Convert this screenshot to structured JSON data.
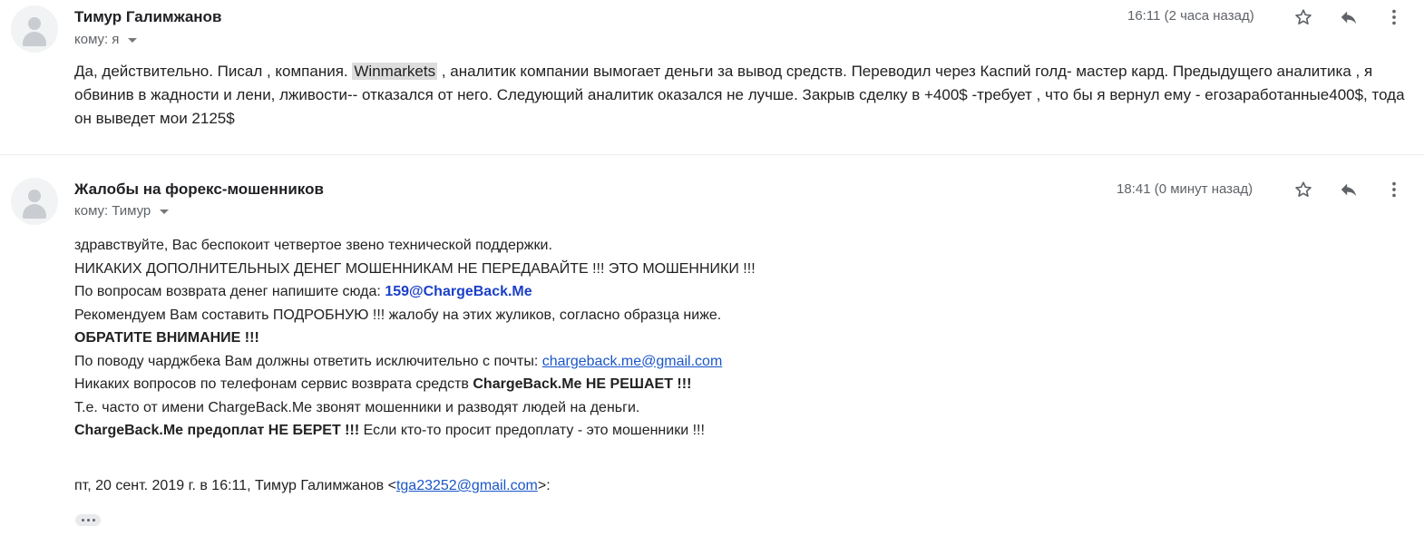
{
  "messages": [
    {
      "sender": "Тимур Галимжанов",
      "to_prefix": "кому:",
      "to_name": "я",
      "time": "16:11 (2 часа назад)",
      "body": {
        "part1": "Да, действительно. Писал , компания. ",
        "highlight": "Winmarkets",
        "part2": " , аналитик компании вымогает деньги за вывод средств. Переводил через Каспий голд- мастер кард. Предыдущего аналитика , я обвинив в жадности и лени, лживости-- отказался от него. Следующий аналитик оказался не лучше. Закрыв сделку в +400$ -требует , что бы я вернул ему - егозаработанные400$, тода он выведет мои 2125$"
      }
    },
    {
      "sender": "Жалобы на форекс-мошенников",
      "to_prefix": "кому:",
      "to_name": "Тимур",
      "time": "18:41 (0 минут назад)",
      "body": {
        "line1": "здравствуйте, Вас беспокоит четвертое звено технической поддержки.",
        "line2": "НИКАКИХ ДОПОЛНИТЕЛЬНЫХ ДЕНЕГ МОШЕННИКАМ НЕ ПЕРЕДАВАЙТЕ !!! ЭТО МОШЕННИКИ !!!",
        "line3_text": "По вопросам возврата денег напишите сюда: ",
        "line3_email": "159@ChargeBack.Me",
        "line4": "Рекомендуем Вам составить ПОДРОБНУЮ !!! жалобу на этих жуликов, согласно образца ниже.",
        "line5": "ОБРАТИТЕ ВНИМАНИЕ !!!",
        "line6_text": "По поводу чарджбека Вам должны ответить исключительно с почты: ",
        "line6_email": "chargeback.me@gmail.com",
        "line7_text": "Никаких вопросов по телефонам сервис возврата средств ",
        "line7_bold": "ChargeBack.Me НЕ РЕШАЕТ !!!",
        "line8": "Т.е. часто от имени ChargeBack.Me звонят мошенники и разводят людей на деньги.",
        "line9_bold": "ChargeBack.Me предоплат НЕ БЕРЕТ !!!",
        "line9_text": " Если кто-то просит предоплату - это мошенники !!!",
        "quote_prefix": "пт, 20 сент. 2019 г. в 16:11, Тимур Галимжанов <",
        "quote_email": "tga23252@gmail.com",
        "quote_suffix": ">:"
      }
    }
  ],
  "icons": {
    "star": "star-icon",
    "reply": "reply-icon",
    "more": "more-vert-icon",
    "avatar": "person-avatar"
  }
}
